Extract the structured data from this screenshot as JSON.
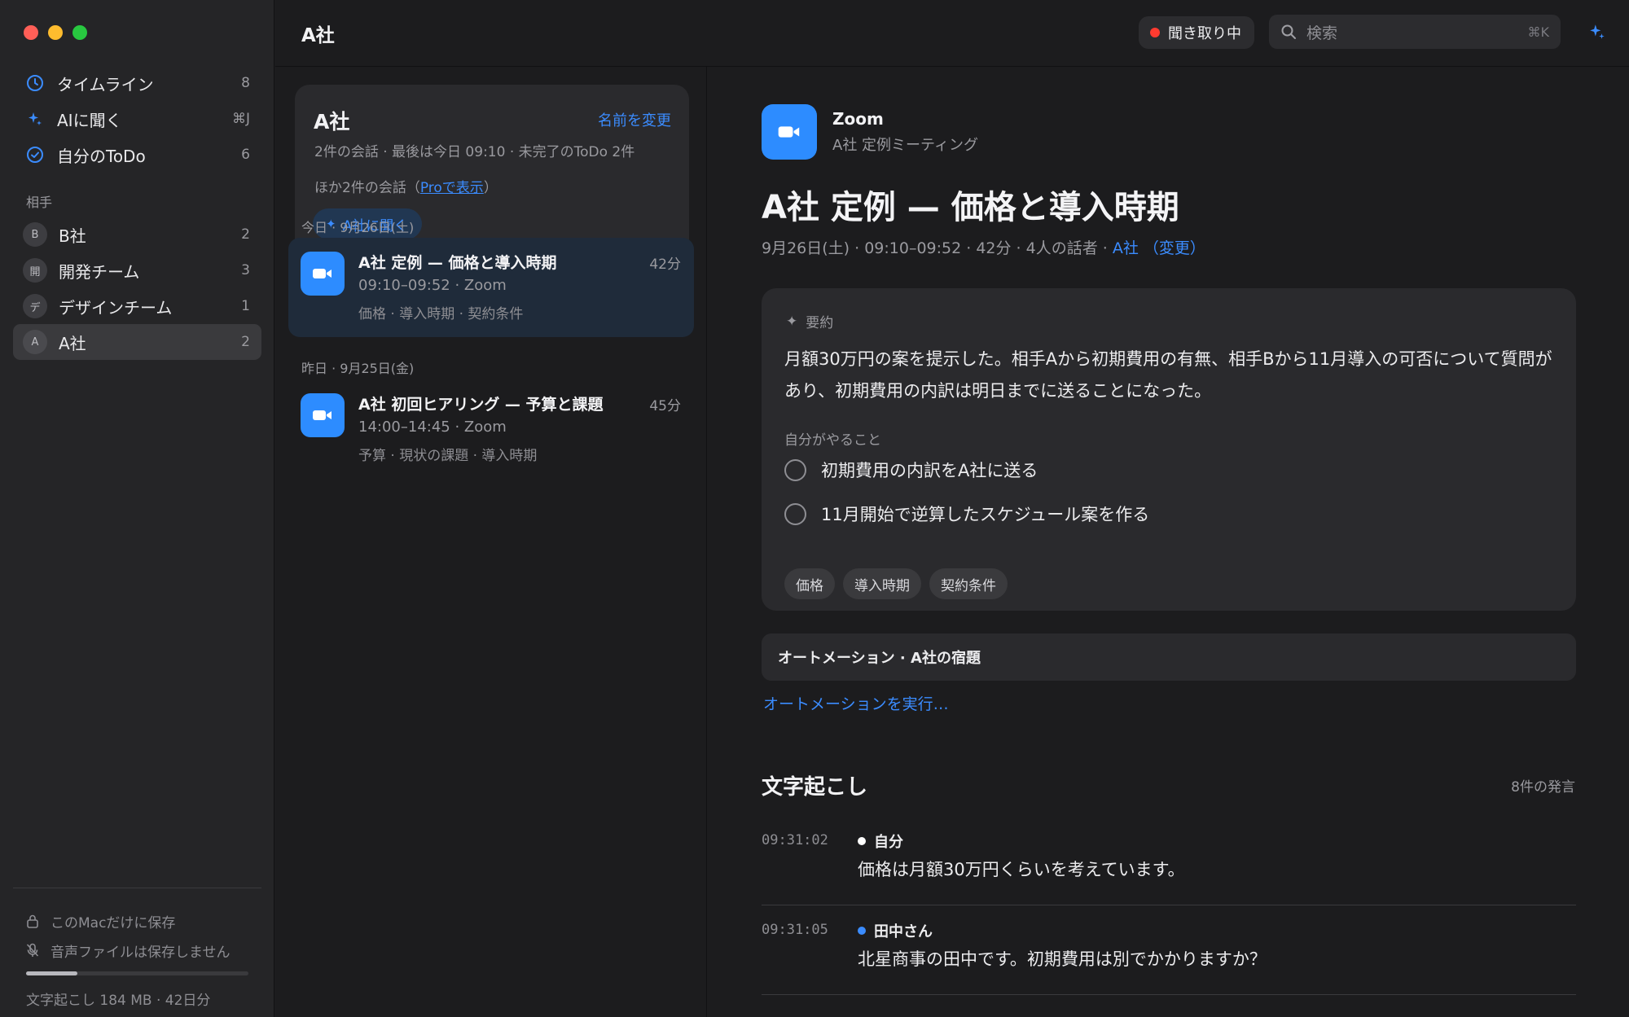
{
  "window": {
    "title": "A社"
  },
  "sidebar": {
    "nav": [
      {
        "label": "タイムライン",
        "count": "8",
        "icon": "clock-icon"
      },
      {
        "label": "AIに聞く",
        "count": "⌘J",
        "icon": "sparkle-icon"
      },
      {
        "label": "自分のToDo",
        "count": "6",
        "icon": "check-circle-icon"
      }
    ],
    "contacts_heading": "相手",
    "contacts": [
      {
        "initial": "B",
        "label": "B社",
        "count": "2"
      },
      {
        "initial": "開",
        "label": "開発チーム",
        "count": "3"
      },
      {
        "initial": "デ",
        "label": "デザインチーム",
        "count": "1"
      },
      {
        "initial": "A",
        "label": "A社",
        "count": "2",
        "active": true
      }
    ],
    "footer": {
      "local_only": "このMacだけに保存",
      "no_audio": "音声ファイルは保存しません",
      "usage_fraction": 0.23,
      "usage_text": "文字起こし 184 MB · 42日分"
    }
  },
  "topbar": {
    "title": "A社",
    "listening_label": "聞き取り中",
    "search_placeholder": "検索",
    "search_shortcut": "⌘K"
  },
  "contact_card": {
    "name": "A社",
    "rename_label": "名前を変更",
    "meta": "2件の会話 · 最後は今日 09:10 · 未完了のToDo 2件",
    "more_prefix": "ほか2件の会話（",
    "more_link": "Proで表示",
    "more_suffix": "）",
    "ask_label": "A社に聞く"
  },
  "meetings": [
    {
      "day_label": "今日 · 9月26日(土)",
      "title": "A社 定例 — 価格と導入時期",
      "duration": "42分",
      "time": "09:10–09:52 · Zoom",
      "tags": "価格 · 導入時期 · 契約条件"
    },
    {
      "day_label": "昨日 · 9月25日(金)",
      "title": "A社 初回ヒアリング — 予算と課題",
      "duration": "45分",
      "time": "14:00–14:45 · Zoom",
      "tags": "予算 · 現状の課題 · 導入時期"
    }
  ],
  "detail": {
    "app": "Zoom",
    "subtitle": "A社 定例ミーティング",
    "title": "A社 定例 — 価格と導入時期",
    "meta": "9月26日(土) · 09:10–09:52 · 42分 · 4人の話者 · ",
    "meta_company": "A社",
    "meta_change": "（変更）",
    "summary_heading": "要約",
    "summary_text": "月額30万円の案を提示した。相手Aから初期費用の有無、相手Bから11月導入の可否について質問があり、初期費用の内訳は明日までに送ることになった。",
    "todo_heading": "自分がやること",
    "todos": [
      "初期費用の内訳をA社に送る",
      "11月開始で逆算したスケジュール案を作る"
    ],
    "tags": [
      "価格",
      "導入時期",
      "契約条件"
    ],
    "automation_label": "オートメーション · A社の宿題",
    "automation_run": "オートメーションを実行…",
    "transcript_heading": "文字起こし",
    "transcript_count": "8件の発言",
    "utterances": [
      {
        "time": "09:31:02",
        "speaker": "自分",
        "color": "#ffffff",
        "text": "価格は月額30万円くらいを考えています。"
      },
      {
        "time": "09:31:05",
        "speaker": "田中さん",
        "color": "#3b8cff",
        "text": "北星商事の田中です。初期費用は別でかかりますか？"
      }
    ]
  },
  "colors": {
    "accent": "#3b8cff",
    "zoom": "#2d8cff",
    "recording": "#ff3b30"
  }
}
